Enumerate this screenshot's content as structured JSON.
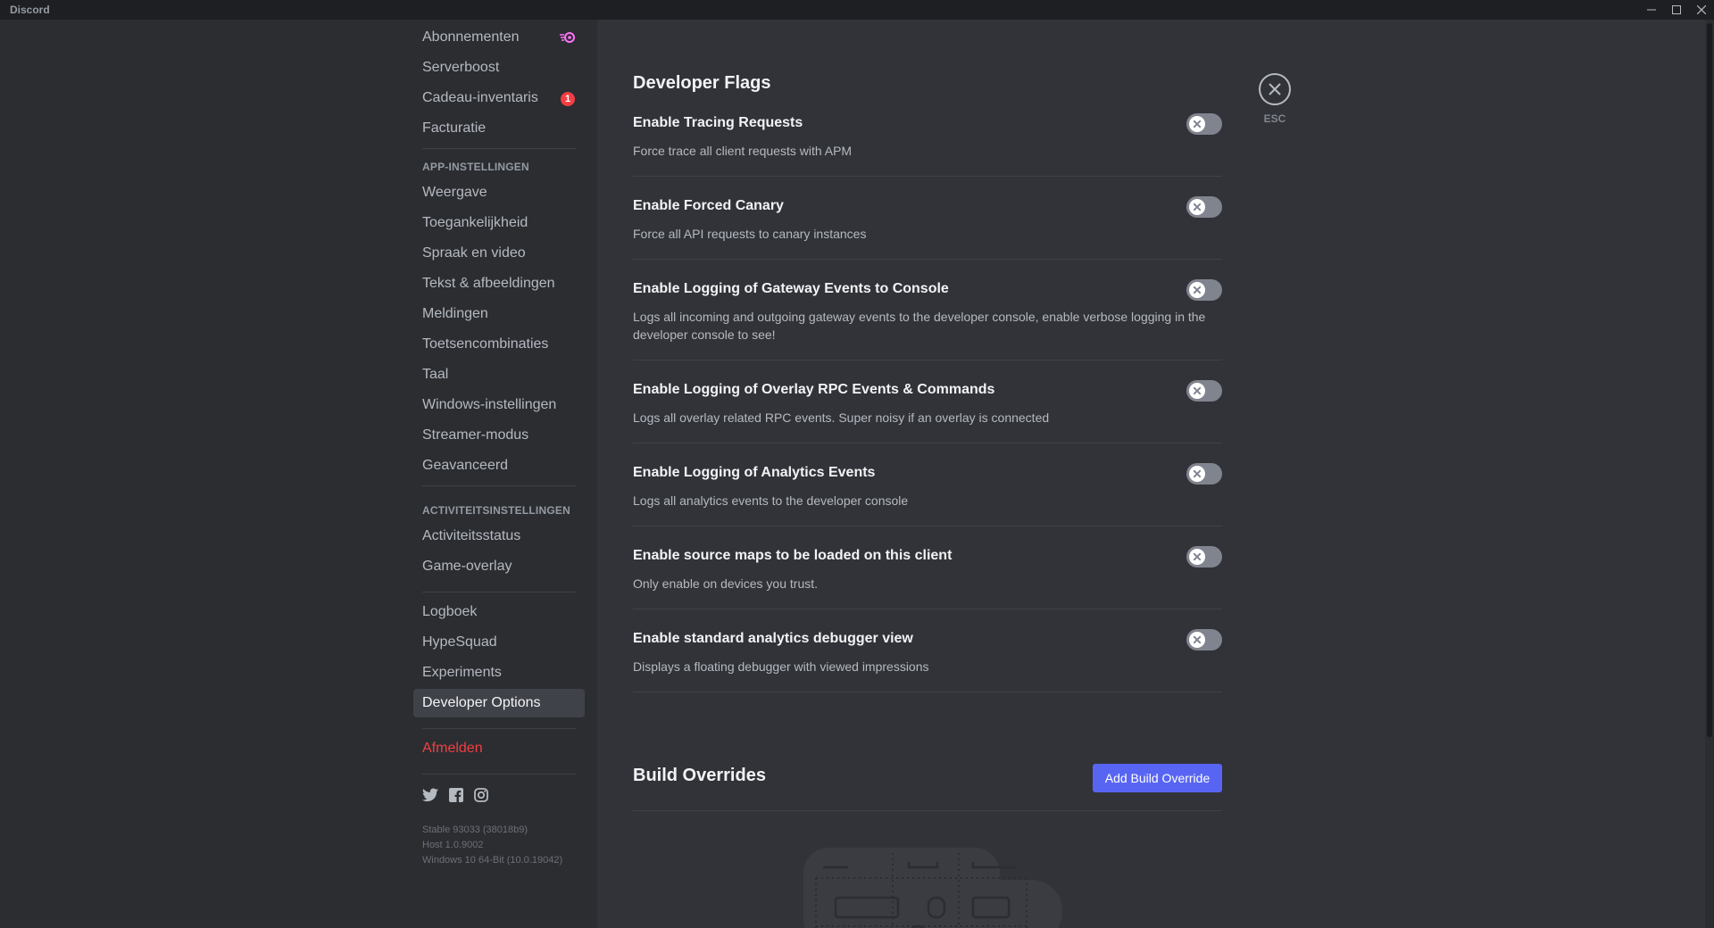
{
  "window": {
    "app_name": "Discord",
    "controls": [
      "minimize",
      "maximize",
      "close"
    ]
  },
  "sidebar": {
    "items_top": [
      {
        "label": "Abonnementen",
        "icon": "nitro-icon"
      },
      {
        "label": "Serverboost"
      },
      {
        "label": "Cadeau-inventaris",
        "badge": "1"
      },
      {
        "label": "Facturatie"
      }
    ],
    "app_settings_header": "APP-INSTELLINGEN",
    "app_settings": [
      "Weergave",
      "Toegankelijkheid",
      "Spraak en video",
      "Tekst & afbeeldingen",
      "Meldingen",
      "Toetsencombinaties",
      "Taal",
      "Windows-instellingen",
      "Streamer-modus",
      "Geavanceerd"
    ],
    "activity_header": "ACTIVITEITSINSTELLINGEN",
    "activity_settings": [
      "Activiteitsstatus",
      "Game-overlay"
    ],
    "misc": [
      "Logboek",
      "HypeSquad",
      "Experiments",
      "Developer Options"
    ],
    "active_item": "Developer Options",
    "logout": "Afmelden",
    "social_icons": [
      "twitter-icon",
      "facebook-icon",
      "instagram-icon"
    ],
    "version": {
      "line1": "Stable 93033 (38018b9)",
      "line2": "Host 1.0.9002",
      "line3": "Windows 10 64-Bit (10.0.19042)"
    }
  },
  "main": {
    "developer_flags_title": "Developer Flags",
    "flags": [
      {
        "title": "Enable Tracing Requests",
        "desc": "Force trace all client requests with APM",
        "enabled": false
      },
      {
        "title": "Enable Forced Canary",
        "desc": "Force all API requests to canary instances",
        "enabled": false
      },
      {
        "title": "Enable Logging of Gateway Events to Console",
        "desc": "Logs all incoming and outgoing gateway events to the developer console, enable verbose logging in the developer console to see!",
        "enabled": false
      },
      {
        "title": "Enable Logging of Overlay RPC Events & Commands",
        "desc": "Logs all overlay related RPC events. Super noisy if an overlay is connected",
        "enabled": false
      },
      {
        "title": "Enable Logging of Analytics Events",
        "desc": "Logs all analytics events to the developer console",
        "enabled": false
      },
      {
        "title": "Enable source maps to be loaded on this client",
        "desc": "Only enable on devices you trust.",
        "enabled": false
      },
      {
        "title": "Enable standard analytics debugger view",
        "desc": "Displays a floating debugger with viewed impressions",
        "enabled": false
      }
    ],
    "build_overrides_title": "Build Overrides",
    "add_build_override_label": "Add Build Override",
    "close_label": "ESC"
  },
  "colors": {
    "accent": "#5865f2",
    "danger": "#f23f43",
    "sidebar_bg": "#2b2d31",
    "content_bg": "#313338"
  }
}
